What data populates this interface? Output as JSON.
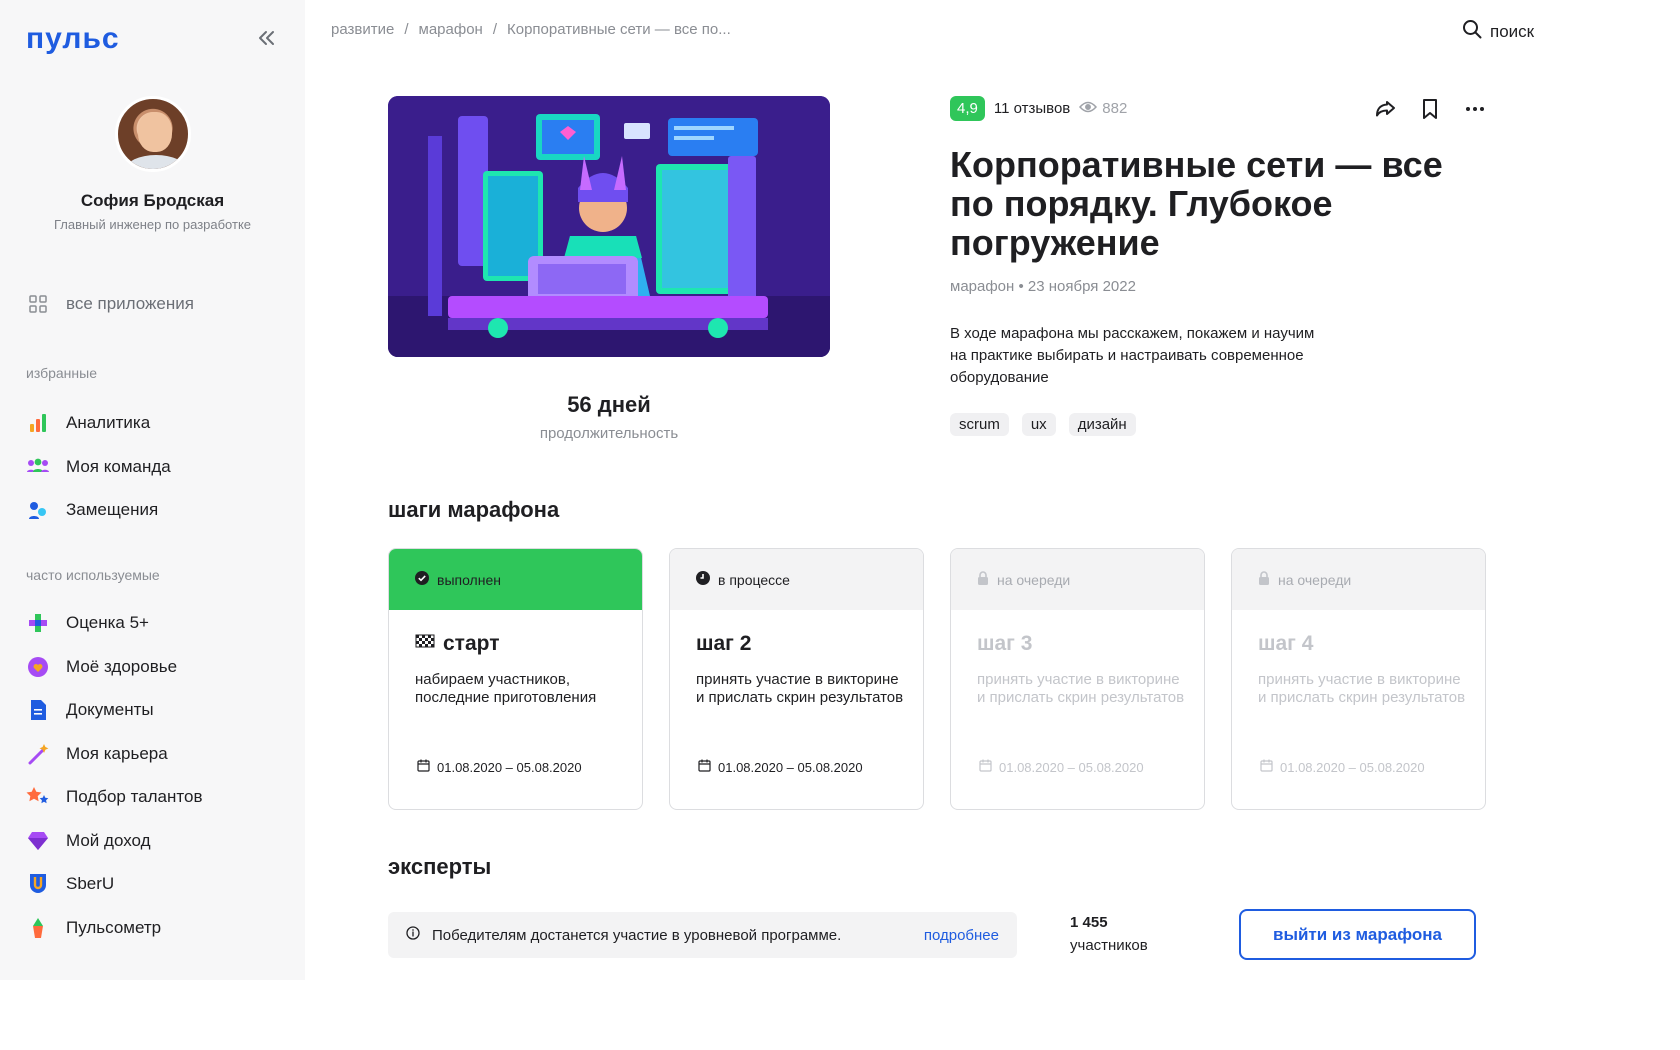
{
  "sidebar": {
    "logo": "пульс",
    "profile": {
      "name": "София Бродская",
      "role": "Главный инженер по разработке"
    },
    "all_apps": "все приложения",
    "favorites_label": "избранные",
    "favorites": [
      {
        "label": "Аналитика",
        "icon": "analytics-icon"
      },
      {
        "label": "Моя команда",
        "icon": "team-icon"
      },
      {
        "label": "Замещения",
        "icon": "substitution-icon"
      }
    ],
    "frequent_label": "часто используемые",
    "frequent": [
      {
        "label": "Оценка 5+",
        "icon": "rating-icon"
      },
      {
        "label": "Моё здоровье",
        "icon": "health-icon"
      },
      {
        "label": "Документы",
        "icon": "documents-icon"
      },
      {
        "label": "Моя карьера",
        "icon": "career-icon"
      },
      {
        "label": "Подбор талантов",
        "icon": "talents-icon"
      },
      {
        "label": "Мой доход",
        "icon": "income-icon"
      },
      {
        "label": "SberU",
        "icon": "sberu-icon"
      },
      {
        "label": "Пульсометр",
        "icon": "pulsometer-icon"
      }
    ]
  },
  "header": {
    "breadcrumb": [
      "развитие",
      "марафон",
      "Корпоративные сети — все по..."
    ],
    "separator": "/",
    "search_label": "поиск"
  },
  "course": {
    "rating": "4,9",
    "reviews": "11 отзывов",
    "views": "882",
    "title": "Корпоративные сети — все по порядку. Глубокое погружение",
    "type": "марафон",
    "meta_separator": "•",
    "date": "23 ноября 2022",
    "description": "В ходе марафона мы расскажем, покажем и научим на практике выбирать и настраивать современное оборудование",
    "tags": [
      "scrum",
      "ux",
      "дизайн"
    ],
    "duration_value": "56 дней",
    "duration_label": "продолжительность"
  },
  "steps_title": "шаги марафона",
  "steps": [
    {
      "status": "выполнен",
      "title": "старт",
      "desc": "набираем участников, последние приготовления",
      "dates": "01.08.2020 – 05.08.2020"
    },
    {
      "status": "в процессе",
      "title": "шаг 2",
      "desc": "принять участие в викторине и прислать скрин результатов",
      "dates": "01.08.2020 – 05.08.2020"
    },
    {
      "status": "на очереди",
      "title": "шаг 3",
      "desc": "принять участие в викторине и прислать скрин результатов",
      "dates": "01.08.2020 – 05.08.2020"
    },
    {
      "status": "на очереди",
      "title": "шаг 4",
      "desc": "принять участие в викторине и прислать скрин результатов",
      "dates": "01.08.2020 – 05.08.2020"
    }
  ],
  "experts_title": "эксперты",
  "notice": {
    "text": "Победителям достанется участие в уровневой программе.",
    "link": "подробнее"
  },
  "participants": {
    "count": "1 455",
    "label": "участников"
  },
  "leave_button": "выйти из марафона",
  "colors": {
    "accent": "#1f5ce0",
    "success": "#2fc65a",
    "sidebar_bg": "#f7f7f8"
  }
}
